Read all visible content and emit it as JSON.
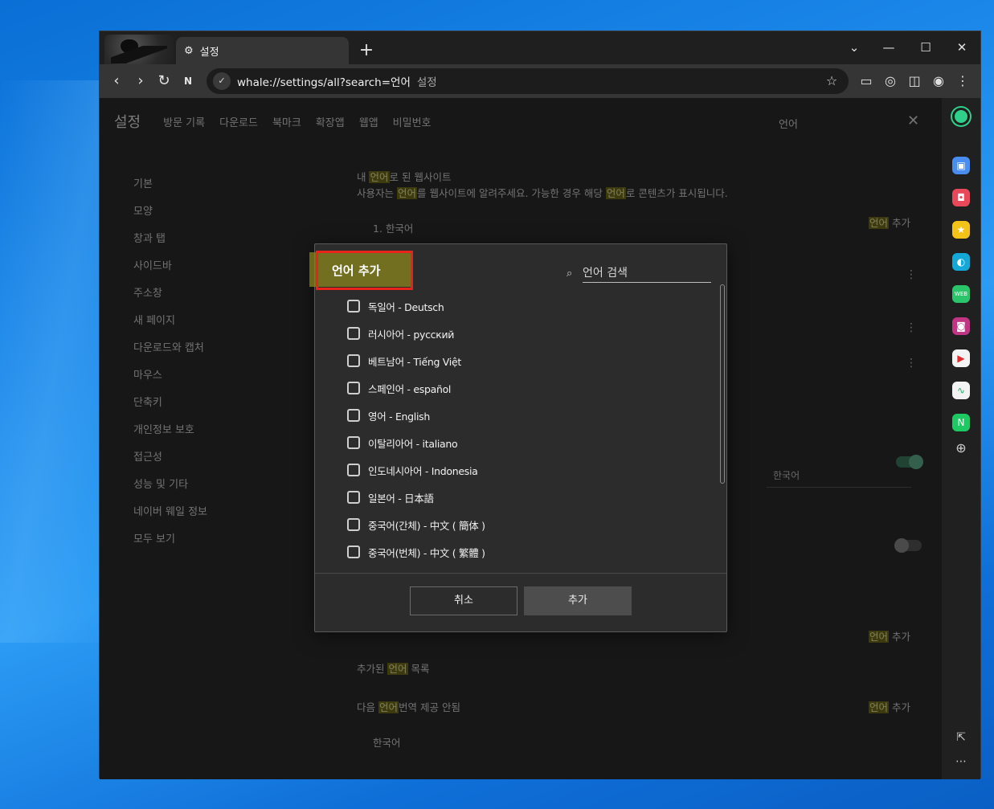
{
  "browser": {
    "tab_title": "설정",
    "new_tab_label": "+",
    "url": "whale://settings/all?search=언어",
    "url_hint": "설정",
    "window_controls": {
      "dropdown": "⌄",
      "minimize": "—",
      "maximize": "☐",
      "close": "✕"
    }
  },
  "settings_page": {
    "title": "설정",
    "header_tabs": [
      "방문 기록",
      "다운로드",
      "북마크",
      "확장앱",
      "웹앱",
      "비밀번호"
    ],
    "search_text": "언어",
    "sidebar": [
      "기본",
      "모양",
      "창과 탭",
      "사이드바",
      "주소창",
      "새 페이지",
      "다운로드와 캡처",
      "마우스",
      "단축키",
      "개인정보 보호",
      "접근성",
      "성능 및 기타",
      "네이버 웨일 정보",
      "모두 보기"
    ],
    "section_title_pre": "내 ",
    "section_title_hl": "언어",
    "section_title_post": "로 된 웹사이트",
    "section_desc_a": "사용자는 ",
    "section_desc_hl1": "언어",
    "section_desc_b": "를 웹사이트에 알려주세요. 가능한 경우 해당 ",
    "section_desc_hl2": "언어",
    "section_desc_c": "로 콘텐츠가 표시됩니다.",
    "first_lang": "1. 한국어",
    "add_hl": "언어",
    "add_label": "추가",
    "dropdown_value": "한국어",
    "bottom_text_pre": "다음 ",
    "bottom_text_hl": "언어",
    "bottom_text_post": "번역 제공 안됨",
    "bottom_lang": "한국어",
    "row_text_pre": "추가된 ",
    "row_text_hl": "언어",
    "row_text_post": " 목록"
  },
  "dialog": {
    "title": "언어 추가",
    "search_placeholder": "언어 검색",
    "languages": [
      "독일어 - Deutsch",
      "러시아어 - русский",
      "베트남어 - Tiếng Việt",
      "스페인어 - español",
      "영어 - English",
      "이탈리아어 - italiano",
      "인도네시아어 - Indonesia",
      "일본어 - 日本語",
      "중국어(간체) - 中文 ( 簡体 )",
      "중국어(번체) - 中文 ( 繁體 )"
    ],
    "cancel_label": "취소",
    "add_label": "추가"
  },
  "colors": {
    "highlight_outline": "#e8231a",
    "search_highlight": "#8a861d",
    "desktop": "#1a86e8"
  },
  "icons": [
    "settings-icon",
    "back-icon",
    "forward-icon",
    "reload-icon",
    "naver-icon",
    "whale-icon",
    "star-add-icon",
    "video-icon",
    "capture-icon",
    "split-view-icon",
    "profile-icon",
    "menu-icon",
    "search-icon"
  ]
}
